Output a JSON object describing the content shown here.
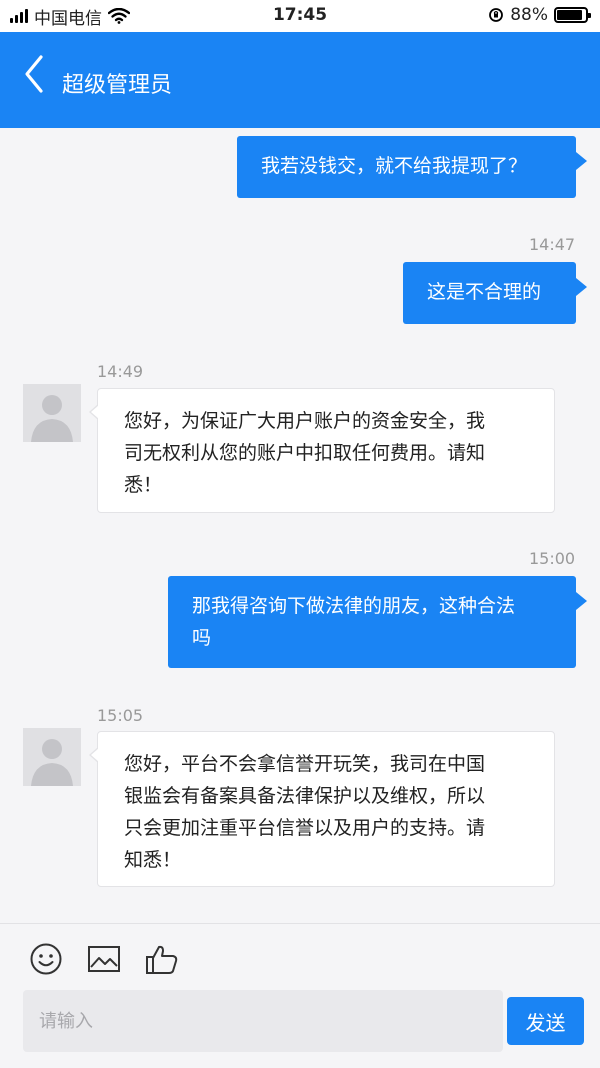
{
  "status_bar": {
    "carrier": "中国电信",
    "time": "17:45",
    "battery": "88%",
    "battery_level": 0.88
  },
  "header": {
    "title": "超级管理员",
    "back_icon": "chevron-left-icon"
  },
  "messages": [
    {
      "direction": "out",
      "text": "我若没钱交，就不给我提现了？"
    },
    {
      "timestamp": "14:47"
    },
    {
      "direction": "out",
      "text": "这是不合理的"
    },
    {
      "timestamp": "14:49"
    },
    {
      "direction": "in",
      "lines": [
        "您好，为保证广大用户账户的资金安全，我",
        "司无权利从您的账户中扣取任何费用。请知",
        "悉！"
      ]
    },
    {
      "timestamp": "15:00"
    },
    {
      "direction": "out",
      "lines": [
        "那我得咨询下做法律的朋友，这种合法",
        "吗"
      ]
    },
    {
      "timestamp": "15:05"
    },
    {
      "direction": "in",
      "lines": [
        "您好，平台不会拿信誉开玩笑，我司在中国",
        "银监会有备案具备法律保护以及维权，所以",
        "只会更加注重平台信誉以及用户的支持。请",
        "知悉！"
      ]
    }
  ],
  "composer": {
    "icons": [
      "smiley-icon",
      "image-icon",
      "thumbs-up-icon"
    ],
    "placeholder": "请输入",
    "send_label": "发送"
  },
  "colors": {
    "accent": "#1a84f4",
    "background": "#f5f5f7"
  }
}
